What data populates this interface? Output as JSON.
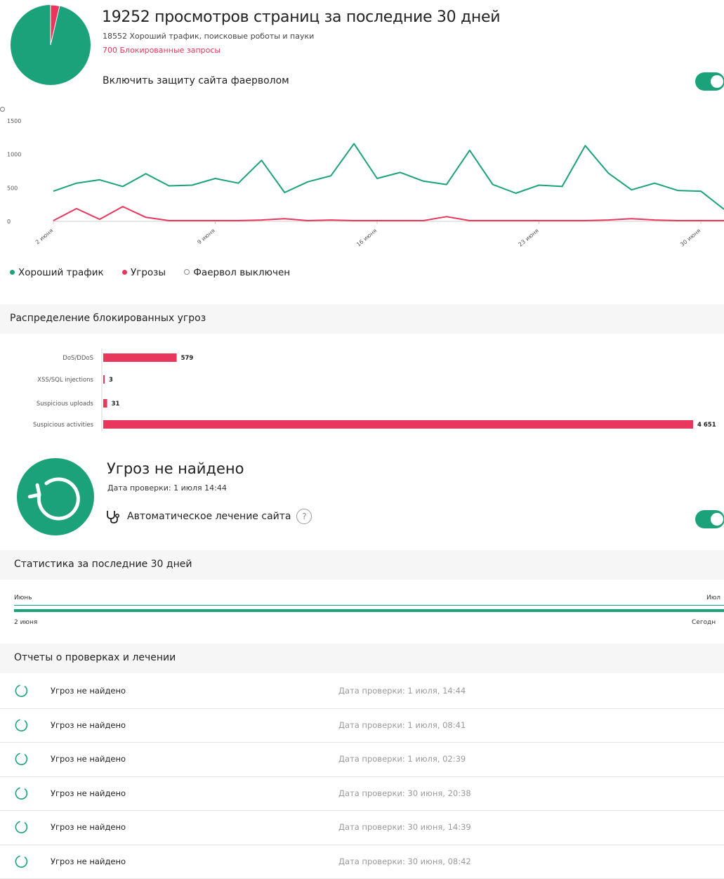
{
  "colors": {
    "good": "#1ba27a",
    "threat": "#e8365d",
    "text": "#222222",
    "muted": "#9a9a9a"
  },
  "firewall": {
    "views_title": "19252 просмотров страниц за последние 30 дней",
    "good_traffic_line": "18552 Хороший трафик, поисковые роботы и пауки",
    "blocked_line": "700 Блокированные запросы",
    "protection_label": "Включить защиту сайта фаерволом",
    "protection_enabled": true,
    "pie": {
      "good": 18552,
      "blocked": 700
    }
  },
  "legend": {
    "good": "Хороший трафик",
    "threats": "Угрозы",
    "firewall_off": "Фаервол выключен"
  },
  "chart_data": [
    {
      "type": "line",
      "x_tick_labels": [
        "2 июня",
        "9 июня",
        "16 июня",
        "23 июня",
        "30 июня"
      ],
      "ylim": [
        0,
        1500
      ],
      "y_ticks": [
        "0",
        "500",
        "1000",
        "1500"
      ],
      "grid": false,
      "series": [
        {
          "name": "Хороший трафик",
          "color": "#1ba27a",
          "values": [
            450,
            570,
            620,
            520,
            710,
            530,
            540,
            640,
            570,
            910,
            430,
            590,
            680,
            1160,
            640,
            730,
            600,
            550,
            1060,
            550,
            420,
            540,
            520,
            1130,
            720,
            470,
            570,
            460,
            450,
            180
          ]
        },
        {
          "name": "Угрозы",
          "color": "#e8365d",
          "values": [
            10,
            190,
            30,
            220,
            60,
            10,
            10,
            10,
            10,
            20,
            40,
            10,
            20,
            10,
            10,
            10,
            10,
            70,
            10,
            10,
            10,
            10,
            10,
            10,
            20,
            40,
            20,
            10,
            10,
            10
          ]
        }
      ]
    },
    {
      "type": "bar",
      "orientation": "horizontal",
      "categories": [
        "DoS/DDoS",
        "XSS/SQL injections",
        "Suspicious uploads",
        "Suspicious activities"
      ],
      "values": [
        579,
        3,
        31,
        4651
      ],
      "value_labels": [
        "579",
        "3",
        "31",
        "4 651"
      ],
      "color": "#e8365d"
    }
  ],
  "distribution": {
    "title": "Распределение блокированных угроз"
  },
  "scan": {
    "title": "Угроз не найдено",
    "date": "Дата проверки: 1 июля 14:44",
    "auto_label": "Автоматическое лечение сайта",
    "help": "?",
    "auto_enabled": true
  },
  "stats": {
    "title": "Статистика за последние 30 дней",
    "month_start": "Июнь",
    "month_end": "Июл",
    "date_start": "2 июня",
    "date_end": "Сегодн"
  },
  "reports": {
    "title": "Отчеты о проверках и лечении",
    "rows": [
      {
        "status": "Угроз не найдено",
        "date": "Дата проверки: 1 июля, 14:44"
      },
      {
        "status": "Угроз не найдено",
        "date": "Дата проверки: 1 июля, 08:41"
      },
      {
        "status": "Угроз не найдено",
        "date": "Дата проверки: 1 июля, 02:39"
      },
      {
        "status": "Угроз не найдено",
        "date": "Дата проверки: 30 июня, 20:38"
      },
      {
        "status": "Угроз не найдено",
        "date": "Дата проверки: 30 июня, 14:39"
      },
      {
        "status": "Угроз не найдено",
        "date": "Дата проверки: 30 июня, 08:42"
      }
    ]
  }
}
